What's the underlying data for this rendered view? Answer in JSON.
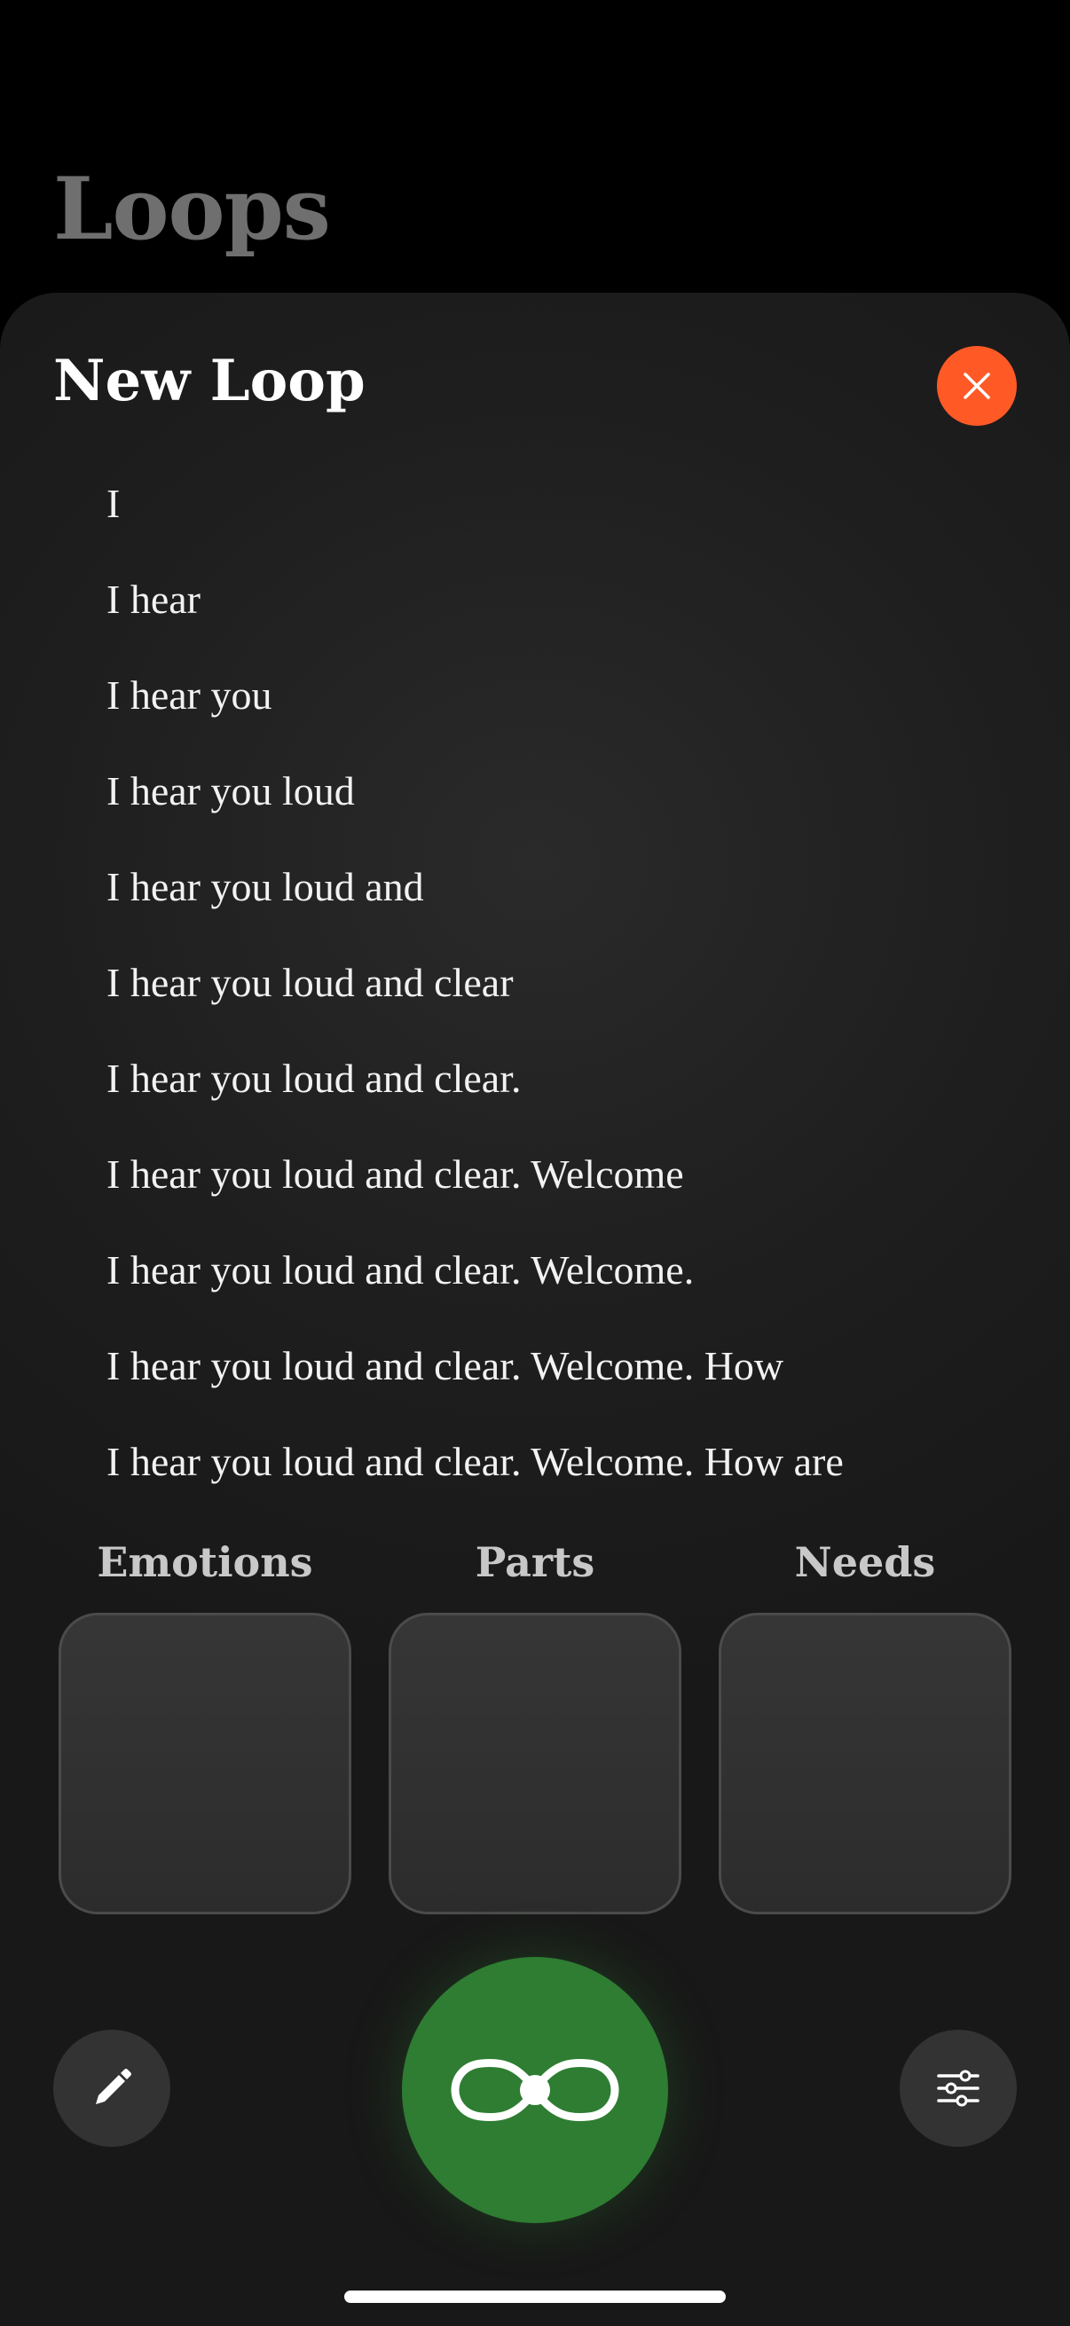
{
  "app": {
    "background_title": "Loops"
  },
  "sheet": {
    "title": "New Loop",
    "close_icon": "close-icon",
    "accent_color": "#ff5a26"
  },
  "transcript": [
    "I",
    "I hear",
    "I hear you",
    "I hear you loud",
    "I hear you loud and",
    "I hear you loud and clear",
    "I hear you loud and clear.",
    "I hear you loud and clear. Welcome",
    "I hear you loud and clear. Welcome.",
    "I hear you loud and clear. Welcome. How",
    "I hear you loud and clear. Welcome. How are"
  ],
  "categories": [
    {
      "label": "Emotions"
    },
    {
      "label": "Parts"
    },
    {
      "label": "Needs"
    }
  ],
  "toolbar": {
    "edit_icon": "pencil-icon",
    "record_icon": "infinity-loop-icon",
    "record_color": "#2e7d32",
    "settings_icon": "sliders-icon"
  }
}
